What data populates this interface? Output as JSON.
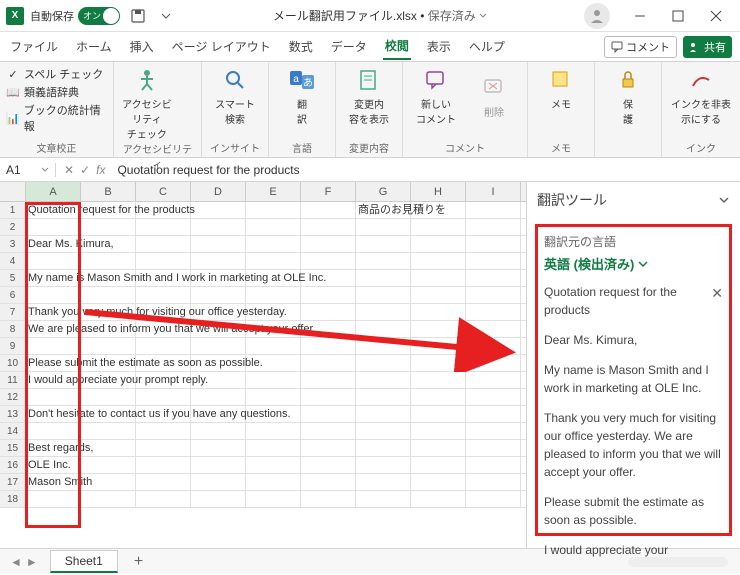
{
  "titlebar": {
    "autosave_label": "自動保存",
    "autosave_toggle_text": "オン",
    "filename": "メール翻訳用ファイル.xlsx",
    "saved_status": "保存済み"
  },
  "tabs": {
    "file": "ファイル",
    "home": "ホーム",
    "insert": "挿入",
    "page_layout": "ページ レイアウト",
    "formulas": "数式",
    "data": "データ",
    "review": "校閲",
    "view": "表示",
    "help": "ヘルプ",
    "comments_btn": "コメント",
    "share_btn": "共有"
  },
  "ribbon": {
    "proofing": {
      "spell": "スペル チェック",
      "thesaurus": "類義語辞典",
      "stats": "ブックの統計情報",
      "label": "文章校正"
    },
    "accessibility": {
      "btn": "アクセシビリティ\nチェック",
      "label": "アクセシビリティ"
    },
    "insights": {
      "btn": "スマート\n検索",
      "label": "インサイト"
    },
    "language": {
      "btn": "翻\n訳",
      "label": "言語"
    },
    "changes": {
      "btn": "変更内\n容を表示",
      "label": "変更内容"
    },
    "comments": {
      "new": "新しい\nコメント",
      "delete": "削除",
      "label": "コメント"
    },
    "notes": {
      "btn": "メモ",
      "label": "メモ"
    },
    "protect": {
      "btn": "保\n護",
      "label": ""
    },
    "ink": {
      "btn": "インクを非表\n示にする",
      "label": "インク"
    }
  },
  "namebox": "A1",
  "formula": "Quotation request for the products",
  "columns": [
    "A",
    "B",
    "C",
    "D",
    "E",
    "F",
    "G",
    "H",
    "I"
  ],
  "rows": [
    {
      "n": "1",
      "a": "Quotation request for the products",
      "g": "商品のお見積りを"
    },
    {
      "n": "2",
      "a": ""
    },
    {
      "n": "3",
      "a": "Dear Ms. Kimura,"
    },
    {
      "n": "4",
      "a": ""
    },
    {
      "n": "5",
      "a": "My name is Mason Smith and I work in marketing at OLE Inc."
    },
    {
      "n": "6",
      "a": ""
    },
    {
      "n": "7",
      "a": "Thank you very much for visiting our office yesterday."
    },
    {
      "n": "8",
      "a": "We are pleased to inform you that we will accept your offer."
    },
    {
      "n": "9",
      "a": ""
    },
    {
      "n": "10",
      "a": "Please submit the estimate as soon as possible."
    },
    {
      "n": "11",
      "a": "I would appreciate your prompt reply."
    },
    {
      "n": "12",
      "a": ""
    },
    {
      "n": "13",
      "a": "Don't hesitate to contact us if you have any questions."
    },
    {
      "n": "14",
      "a": ""
    },
    {
      "n": "15",
      "a": "Best regards,"
    },
    {
      "n": "16",
      "a": "OLE Inc."
    },
    {
      "n": "17",
      "a": "Mason Smith"
    },
    {
      "n": "18",
      "a": ""
    }
  ],
  "pane": {
    "title": "翻訳ツール",
    "src_label": "翻訳元の言語",
    "src_lang": "英語 (検出済み)",
    "paragraphs": [
      "Quotation request for the products",
      "Dear Ms. Kimura,",
      "My name is Mason Smith and I work in marketing at OLE Inc.",
      "Thank you very much for visiting our office yesterday. We are pleased to inform you that we will accept your offer.",
      "Please submit the estimate as soon as possible."
    ],
    "truncated": "I would appreciate your"
  },
  "sheet": {
    "name": "Sheet1"
  }
}
